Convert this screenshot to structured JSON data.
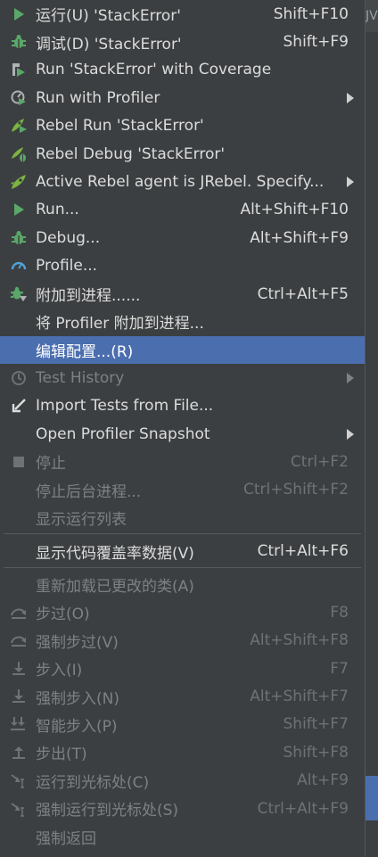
{
  "menu": {
    "items": [
      {
        "icon": "run-icon",
        "label": "运行(U) 'StackError'",
        "shortcut": "Shift+F10",
        "submenu": false,
        "disabled": false
      },
      {
        "icon": "debug-bug-icon",
        "label": "调试(D) 'StackError'",
        "shortcut": "Shift+F9",
        "submenu": false,
        "disabled": false
      },
      {
        "icon": "run-with-coverage-icon",
        "label": "Run 'StackError' with Coverage",
        "shortcut": "",
        "submenu": false,
        "disabled": false
      },
      {
        "icon": "profiler-icon",
        "label": "Run with Profiler",
        "shortcut": "",
        "submenu": true,
        "disabled": false
      },
      {
        "icon": "rebel-run-icon",
        "label": "Rebel Run 'StackError'",
        "shortcut": "",
        "submenu": false,
        "disabled": false
      },
      {
        "icon": "rebel-debug-icon",
        "label": "Rebel Debug 'StackError'",
        "shortcut": "",
        "submenu": false,
        "disabled": false
      },
      {
        "icon": "rebel-agent-icon",
        "label": "Active Rebel agent is JRebel. Specify...",
        "shortcut": "",
        "submenu": true,
        "disabled": false
      },
      {
        "icon": "run-icon",
        "label": "Run...",
        "shortcut": "Alt+Shift+F10",
        "submenu": false,
        "disabled": false
      },
      {
        "icon": "debug-bug-icon",
        "label": "Debug...",
        "shortcut": "Alt+Shift+F9",
        "submenu": false,
        "disabled": false
      },
      {
        "icon": "profile-gauge-icon",
        "label": "Profile...",
        "shortcut": "",
        "submenu": false,
        "disabled": false
      },
      {
        "icon": "attach-debugger-icon",
        "label": "附加到进程......",
        "shortcut": "Ctrl+Alt+F5",
        "submenu": false,
        "disabled": false
      },
      {
        "icon": "",
        "label": "将 Profiler 附加到进程...",
        "shortcut": "",
        "submenu": false,
        "disabled": false
      },
      {
        "icon": "",
        "label": "编辑配置...(R)",
        "shortcut": "",
        "submenu": false,
        "disabled": false,
        "selected": true
      },
      {
        "icon": "clock-history-icon",
        "label": "Test History",
        "shortcut": "",
        "submenu": true,
        "disabled": true
      },
      {
        "icon": "import-arrow-icon",
        "label": "Import Tests from File...",
        "shortcut": "",
        "submenu": false,
        "disabled": false
      },
      {
        "icon": "",
        "label": "Open Profiler Snapshot",
        "shortcut": "",
        "submenu": true,
        "disabled": false
      },
      {
        "icon": "stop-square-icon",
        "label": "停止",
        "shortcut": "Ctrl+F2",
        "submenu": false,
        "disabled": true
      },
      {
        "icon": "",
        "label": "停止后台进程...",
        "shortcut": "Ctrl+Shift+F2",
        "submenu": false,
        "disabled": true
      },
      {
        "icon": "",
        "label": "显示运行列表",
        "shortcut": "",
        "submenu": false,
        "disabled": true
      },
      {
        "separator": true
      },
      {
        "icon": "",
        "label": "显示代码覆盖率数据(V)",
        "shortcut": "Ctrl+Alt+F6",
        "submenu": false,
        "disabled": false
      },
      {
        "separator": true
      },
      {
        "icon": "",
        "label": "重新加载已更改的类(A)",
        "shortcut": "",
        "submenu": false,
        "disabled": true
      },
      {
        "icon": "step-over-icon",
        "label": "步过(O)",
        "shortcut": "F8",
        "submenu": false,
        "disabled": true
      },
      {
        "icon": "force-step-over-icon",
        "label": "强制步过(V)",
        "shortcut": "Alt+Shift+F8",
        "submenu": false,
        "disabled": true
      },
      {
        "icon": "step-into-icon",
        "label": "步入(I)",
        "shortcut": "F7",
        "submenu": false,
        "disabled": true
      },
      {
        "icon": "force-step-into-icon",
        "label": "强制步入(N)",
        "shortcut": "Alt+Shift+F7",
        "submenu": false,
        "disabled": true
      },
      {
        "icon": "smart-step-into-icon",
        "label": "智能步入(P)",
        "shortcut": "Shift+F7",
        "submenu": false,
        "disabled": true
      },
      {
        "icon": "step-out-icon",
        "label": "步出(T)",
        "shortcut": "Shift+F8",
        "submenu": false,
        "disabled": true
      },
      {
        "icon": "run-to-cursor-icon",
        "label": "运行到光标处(C)",
        "shortcut": "Alt+F9",
        "submenu": false,
        "disabled": true
      },
      {
        "icon": "force-run-to-cursor-icon",
        "label": "强制运行到光标处(S)",
        "shortcut": "Ctrl+Alt+F9",
        "submenu": false,
        "disabled": true
      },
      {
        "icon": "",
        "label": "强制返回",
        "shortcut": "",
        "submenu": false,
        "disabled": true
      }
    ]
  },
  "background_edge_text": "JV",
  "colors": {
    "menu_bg": "#3c3f41",
    "selected_bg": "#4b6eaf",
    "run_green": "#59a869",
    "text": "#dcdcdc",
    "disabled_text": "#7d8184"
  }
}
